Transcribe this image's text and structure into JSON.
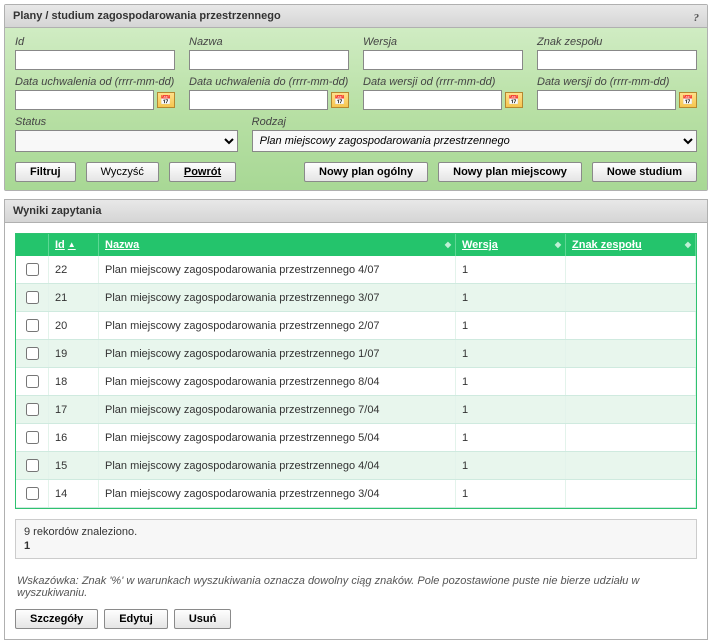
{
  "panel_title": "Plany / studium zagospodarowania przestrzennego",
  "help_icon": "?",
  "filters": {
    "id_label": "Id",
    "nazwa_label": "Nazwa",
    "wersja_label": "Wersja",
    "znak_label": "Znak zespołu",
    "data_uchw_od_label": "Data uchwalenia od (rrrr-mm-dd)",
    "data_uchw_do_label": "Data uchwalenia do (rrrr-mm-dd)",
    "data_wer_od_label": "Data wersji od (rrrr-mm-dd)",
    "data_wer_do_label": "Data wersji do (rrrr-mm-dd)",
    "status_label": "Status",
    "rodzaj_label": "Rodzaj",
    "rodzaj_selected": "Plan miejscowy zagospodarowania przestrzennego"
  },
  "buttons": {
    "filtruj": "Filtruj",
    "wyczysc": "Wyczyść",
    "powrot": "Powrót",
    "nowy_ogolny": "Nowy plan ogólny",
    "nowy_miejscowy": "Nowy plan miejscowy",
    "nowe_studium": "Nowe studium",
    "szczegoly": "Szczegóły",
    "edytuj": "Edytuj",
    "usun": "Usuń"
  },
  "results_title": "Wyniki zapytania",
  "columns": {
    "id": "Id",
    "nazwa": "Nazwa",
    "wersja": "Wersja",
    "znak": "Znak zespołu"
  },
  "rows": [
    {
      "id": "22",
      "nazwa": "Plan miejscowy zagospodarowania przestrzennego 4/07",
      "wersja": "1",
      "znak": ""
    },
    {
      "id": "21",
      "nazwa": "Plan miejscowy zagospodarowania przestrzennego 3/07",
      "wersja": "1",
      "znak": ""
    },
    {
      "id": "20",
      "nazwa": "Plan miejscowy zagospodarowania przestrzennego 2/07",
      "wersja": "1",
      "znak": ""
    },
    {
      "id": "19",
      "nazwa": "Plan miejscowy zagospodarowania przestrzennego 1/07",
      "wersja": "1",
      "znak": ""
    },
    {
      "id": "18",
      "nazwa": "Plan miejscowy zagospodarowania przestrzennego 8/04",
      "wersja": "1",
      "znak": ""
    },
    {
      "id": "17",
      "nazwa": "Plan miejscowy zagospodarowania przestrzennego 7/04",
      "wersja": "1",
      "znak": ""
    },
    {
      "id": "16",
      "nazwa": "Plan miejscowy zagospodarowania przestrzennego 5/04",
      "wersja": "1",
      "znak": ""
    },
    {
      "id": "15",
      "nazwa": "Plan miejscowy zagospodarowania przestrzennego 4/04",
      "wersja": "1",
      "znak": ""
    },
    {
      "id": "14",
      "nazwa": "Plan miejscowy zagospodarowania przestrzennego 3/04",
      "wersja": "1",
      "znak": ""
    }
  ],
  "summary_text": "9 rekordów znaleziono.",
  "page_number": "1",
  "hint_label": "Wskazówka:",
  "hint_text": "Znak '%' w warunkach wyszukiwania oznacza dowolny ciąg znaków. Pole pozostawione puste nie bierze udziału w wyszukiwaniu."
}
